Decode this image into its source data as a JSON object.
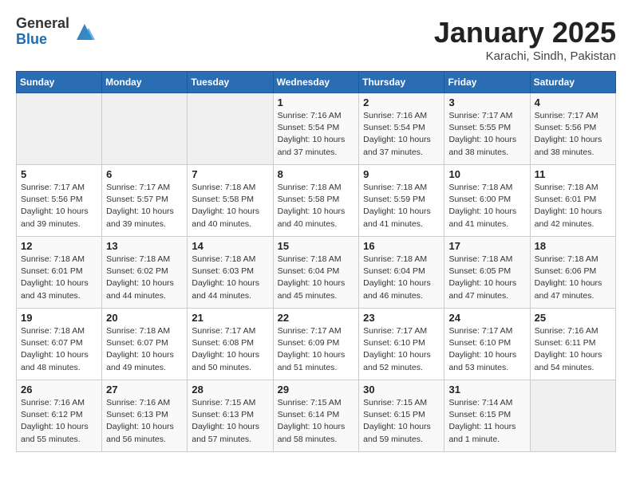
{
  "header": {
    "logo_general": "General",
    "logo_blue": "Blue",
    "month_title": "January 2025",
    "location": "Karachi, Sindh, Pakistan"
  },
  "weekdays": [
    "Sunday",
    "Monday",
    "Tuesday",
    "Wednesday",
    "Thursday",
    "Friday",
    "Saturday"
  ],
  "weeks": [
    [
      {
        "day": "",
        "info": ""
      },
      {
        "day": "",
        "info": ""
      },
      {
        "day": "",
        "info": ""
      },
      {
        "day": "1",
        "info": "Sunrise: 7:16 AM\nSunset: 5:54 PM\nDaylight: 10 hours\nand 37 minutes."
      },
      {
        "day": "2",
        "info": "Sunrise: 7:16 AM\nSunset: 5:54 PM\nDaylight: 10 hours\nand 37 minutes."
      },
      {
        "day": "3",
        "info": "Sunrise: 7:17 AM\nSunset: 5:55 PM\nDaylight: 10 hours\nand 38 minutes."
      },
      {
        "day": "4",
        "info": "Sunrise: 7:17 AM\nSunset: 5:56 PM\nDaylight: 10 hours\nand 38 minutes."
      }
    ],
    [
      {
        "day": "5",
        "info": "Sunrise: 7:17 AM\nSunset: 5:56 PM\nDaylight: 10 hours\nand 39 minutes."
      },
      {
        "day": "6",
        "info": "Sunrise: 7:17 AM\nSunset: 5:57 PM\nDaylight: 10 hours\nand 39 minutes."
      },
      {
        "day": "7",
        "info": "Sunrise: 7:18 AM\nSunset: 5:58 PM\nDaylight: 10 hours\nand 40 minutes."
      },
      {
        "day": "8",
        "info": "Sunrise: 7:18 AM\nSunset: 5:58 PM\nDaylight: 10 hours\nand 40 minutes."
      },
      {
        "day": "9",
        "info": "Sunrise: 7:18 AM\nSunset: 5:59 PM\nDaylight: 10 hours\nand 41 minutes."
      },
      {
        "day": "10",
        "info": "Sunrise: 7:18 AM\nSunset: 6:00 PM\nDaylight: 10 hours\nand 41 minutes."
      },
      {
        "day": "11",
        "info": "Sunrise: 7:18 AM\nSunset: 6:01 PM\nDaylight: 10 hours\nand 42 minutes."
      }
    ],
    [
      {
        "day": "12",
        "info": "Sunrise: 7:18 AM\nSunset: 6:01 PM\nDaylight: 10 hours\nand 43 minutes."
      },
      {
        "day": "13",
        "info": "Sunrise: 7:18 AM\nSunset: 6:02 PM\nDaylight: 10 hours\nand 44 minutes."
      },
      {
        "day": "14",
        "info": "Sunrise: 7:18 AM\nSunset: 6:03 PM\nDaylight: 10 hours\nand 44 minutes."
      },
      {
        "day": "15",
        "info": "Sunrise: 7:18 AM\nSunset: 6:04 PM\nDaylight: 10 hours\nand 45 minutes."
      },
      {
        "day": "16",
        "info": "Sunrise: 7:18 AM\nSunset: 6:04 PM\nDaylight: 10 hours\nand 46 minutes."
      },
      {
        "day": "17",
        "info": "Sunrise: 7:18 AM\nSunset: 6:05 PM\nDaylight: 10 hours\nand 47 minutes."
      },
      {
        "day": "18",
        "info": "Sunrise: 7:18 AM\nSunset: 6:06 PM\nDaylight: 10 hours\nand 47 minutes."
      }
    ],
    [
      {
        "day": "19",
        "info": "Sunrise: 7:18 AM\nSunset: 6:07 PM\nDaylight: 10 hours\nand 48 minutes."
      },
      {
        "day": "20",
        "info": "Sunrise: 7:18 AM\nSunset: 6:07 PM\nDaylight: 10 hours\nand 49 minutes."
      },
      {
        "day": "21",
        "info": "Sunrise: 7:17 AM\nSunset: 6:08 PM\nDaylight: 10 hours\nand 50 minutes."
      },
      {
        "day": "22",
        "info": "Sunrise: 7:17 AM\nSunset: 6:09 PM\nDaylight: 10 hours\nand 51 minutes."
      },
      {
        "day": "23",
        "info": "Sunrise: 7:17 AM\nSunset: 6:10 PM\nDaylight: 10 hours\nand 52 minutes."
      },
      {
        "day": "24",
        "info": "Sunrise: 7:17 AM\nSunset: 6:10 PM\nDaylight: 10 hours\nand 53 minutes."
      },
      {
        "day": "25",
        "info": "Sunrise: 7:16 AM\nSunset: 6:11 PM\nDaylight: 10 hours\nand 54 minutes."
      }
    ],
    [
      {
        "day": "26",
        "info": "Sunrise: 7:16 AM\nSunset: 6:12 PM\nDaylight: 10 hours\nand 55 minutes."
      },
      {
        "day": "27",
        "info": "Sunrise: 7:16 AM\nSunset: 6:13 PM\nDaylight: 10 hours\nand 56 minutes."
      },
      {
        "day": "28",
        "info": "Sunrise: 7:15 AM\nSunset: 6:13 PM\nDaylight: 10 hours\nand 57 minutes."
      },
      {
        "day": "29",
        "info": "Sunrise: 7:15 AM\nSunset: 6:14 PM\nDaylight: 10 hours\nand 58 minutes."
      },
      {
        "day": "30",
        "info": "Sunrise: 7:15 AM\nSunset: 6:15 PM\nDaylight: 10 hours\nand 59 minutes."
      },
      {
        "day": "31",
        "info": "Sunrise: 7:14 AM\nSunset: 6:15 PM\nDaylight: 11 hours\nand 1 minute."
      },
      {
        "day": "",
        "info": ""
      }
    ]
  ]
}
